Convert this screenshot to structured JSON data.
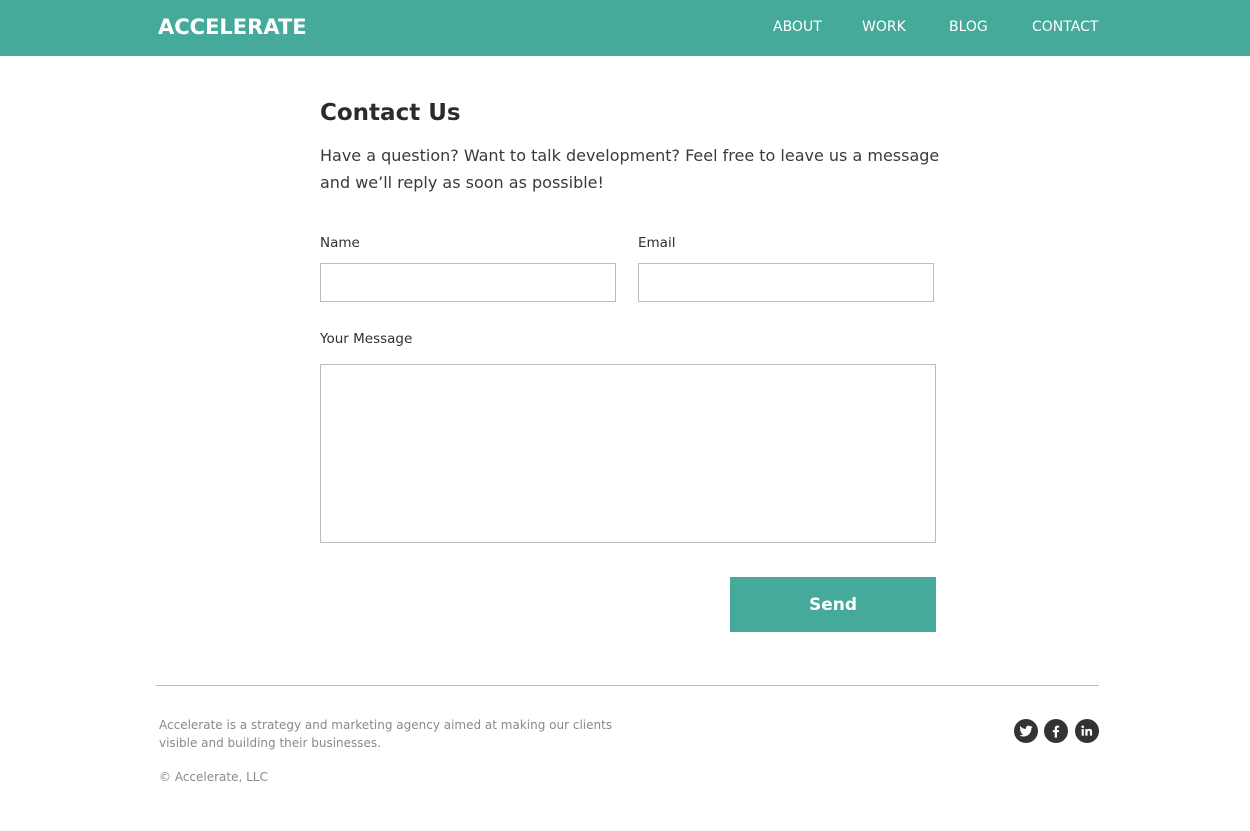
{
  "header": {
    "logo": "ACCELERATE",
    "nav": [
      {
        "label": "ABOUT"
      },
      {
        "label": "WORK"
      },
      {
        "label": "BLOG"
      },
      {
        "label": "CONTACT"
      }
    ]
  },
  "main": {
    "title": "Contact Us",
    "intro": "Have a question? Want to talk development? Feel free to leave us a message and we’ll reply as soon as possible!",
    "form": {
      "name_label": "Name",
      "name_value": "",
      "name_placeholder": "",
      "email_label": "Email",
      "email_value": "",
      "email_placeholder": "",
      "message_label": "Your Message",
      "message_value": "",
      "message_placeholder": "",
      "send_label": "Send"
    }
  },
  "footer": {
    "description": "Accelerate is a strategy and marketing agency aimed at making our clients visible and building their businesses.",
    "copyright": "© Accelerate, LLC",
    "social": [
      {
        "name": "twitter",
        "icon": "twitter-icon"
      },
      {
        "name": "facebook",
        "icon": "facebook-icon"
      },
      {
        "name": "linkedin",
        "icon": "linkedin-icon"
      }
    ]
  },
  "colors": {
    "brand": "#45aa9a",
    "text": "#333333",
    "muted": "#8a8a8a",
    "border": "#bdbdbd"
  }
}
